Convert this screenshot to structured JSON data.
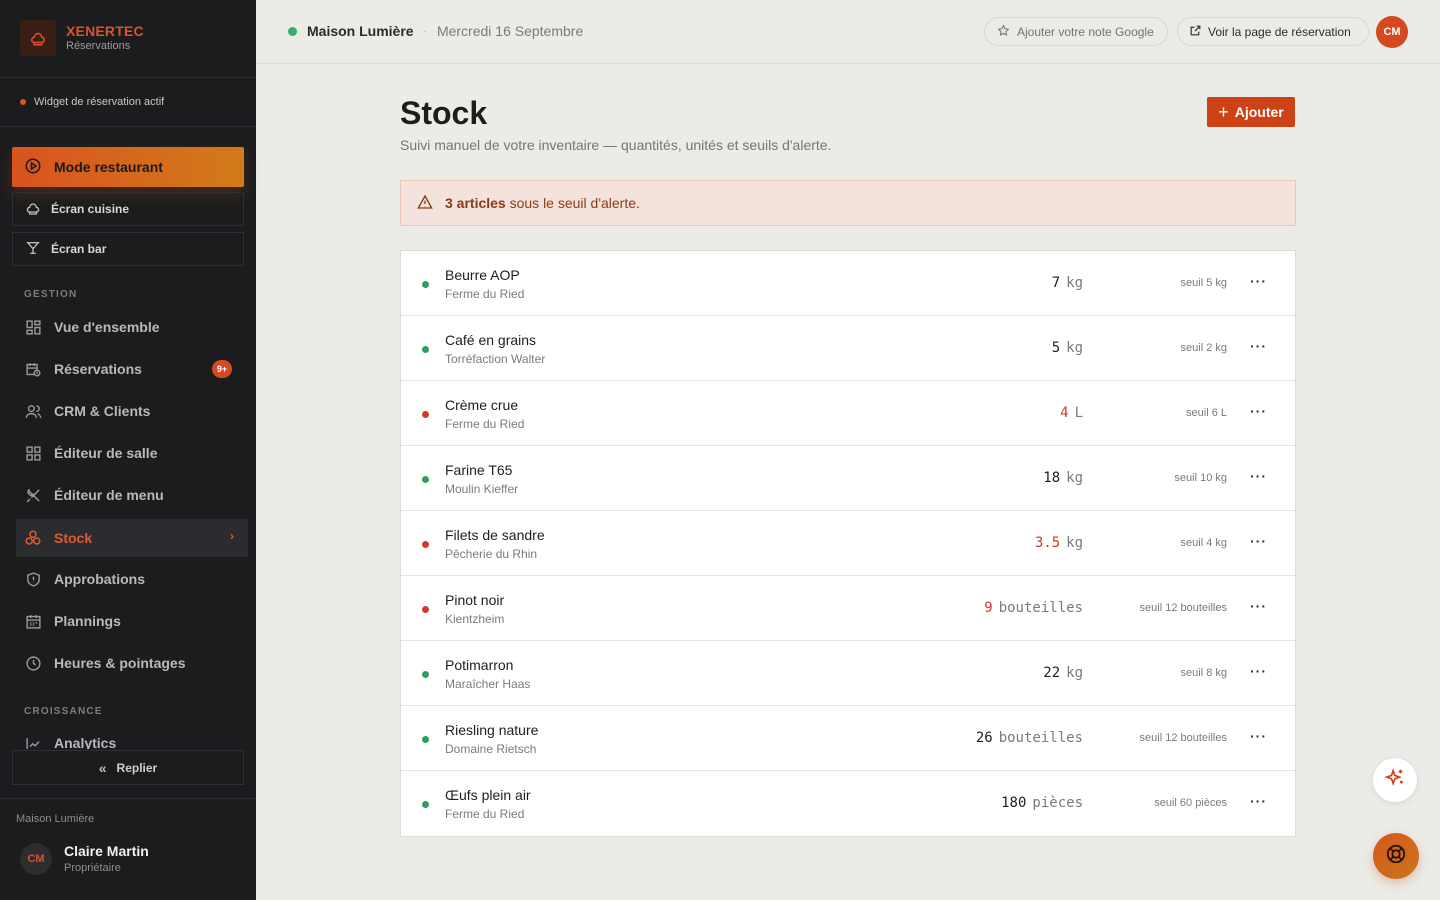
{
  "brand": {
    "name": "XENERTEC",
    "subtitle": "Réservations"
  },
  "widget_status": "Widget de réservation actif",
  "mode_button": "Mode restaurant",
  "screens": {
    "kitchen": "Écran cuisine",
    "bar": "Écran bar"
  },
  "sections": {
    "gestion": "GESTION",
    "croissance": "CROISSANCE"
  },
  "nav": {
    "overview": "Vue d'ensemble",
    "reservations": "Réservations",
    "reservations_badge": "9+",
    "crm": "CRM & Clients",
    "room_editor": "Éditeur de salle",
    "menu_editor": "Éditeur de menu",
    "stock": "Stock",
    "supplies": "Approbations",
    "schedules": "Plannings",
    "hours": "Heures & pointages",
    "analytics": "Analytics"
  },
  "collapse_label": "Replier",
  "footer": {
    "restaurant": "Maison Lumière",
    "user_initials": "CM",
    "user_name": "Claire Martin",
    "user_role": "Propriétaire"
  },
  "topbar": {
    "restaurant": "Maison Lumière",
    "separator": "·",
    "date": "Mercredi 16 Septembre",
    "google_rating": "Ajouter votre note Google",
    "booking_page": "Voir la page de réservation",
    "avatar_initials": "CM"
  },
  "page": {
    "title": "Stock",
    "subtitle": "Suivi manuel de votre inventaire — quantités, unités et seuils d'alerte.",
    "add_button": "Ajouter"
  },
  "alert": {
    "count_text": "3 articles",
    "rest_text": " sous le seuil d'alerte."
  },
  "colors": {
    "accent": "#cc4215",
    "ok": "#2f9e5b",
    "low": "#d13a2a"
  },
  "items": [
    {
      "name": "Beurre AOP",
      "supplier": "Ferme du Ried",
      "qty": "7",
      "unit": "kg",
      "threshold": "seuil 5 kg",
      "low": false
    },
    {
      "name": "Café en grains",
      "supplier": "Torréfaction Walter",
      "qty": "5",
      "unit": "kg",
      "threshold": "seuil 2 kg",
      "low": false
    },
    {
      "name": "Crème crue",
      "supplier": "Ferme du Ried",
      "qty": "4",
      "unit": "L",
      "threshold": "seuil 6 L",
      "low": true
    },
    {
      "name": "Farine T65",
      "supplier": "Moulin Kieffer",
      "qty": "18",
      "unit": "kg",
      "threshold": "seuil 10 kg",
      "low": false
    },
    {
      "name": "Filets de sandre",
      "supplier": "Pêcherie du Rhin",
      "qty": "3.5",
      "unit": "kg",
      "threshold": "seuil 4 kg",
      "low": true
    },
    {
      "name": "Pinot noir",
      "supplier": "Kientzheim",
      "qty": "9",
      "unit": "bouteilles",
      "threshold": "seuil 12 bouteilles",
      "low": true
    },
    {
      "name": "Potimarron",
      "supplier": "Maraîcher Haas",
      "qty": "22",
      "unit": "kg",
      "threshold": "seuil 8 kg",
      "low": false
    },
    {
      "name": "Riesling nature",
      "supplier": "Domaine Rietsch",
      "qty": "26",
      "unit": "bouteilles",
      "threshold": "seuil 12 bouteilles",
      "low": false
    },
    {
      "name": "Œufs plein air",
      "supplier": "Ferme du Ried",
      "qty": "180",
      "unit": "pièces",
      "threshold": "seuil 60 pièces",
      "low": false
    }
  ],
  "row_menu_glyph": "···"
}
